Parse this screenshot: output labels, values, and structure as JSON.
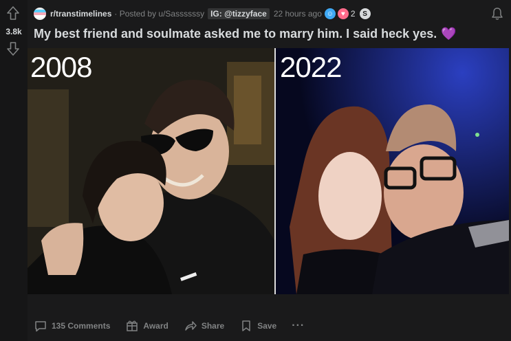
{
  "vote": {
    "count": "3.8k"
  },
  "meta": {
    "subreddit": "r/transtimelines",
    "posted_by": "· Posted by u/Sassssssy",
    "flair": "IG: @tizzyface",
    "time": "22 hours ago",
    "award_count": "2",
    "award_c_glyph": "S"
  },
  "post": {
    "title": "My best friend and soulmate asked me to marry him. I said heck yes.",
    "title_emoji": "💜"
  },
  "image": {
    "left_year": "2008",
    "right_year": "2022"
  },
  "actions": {
    "comments": "135 Comments",
    "award": "Award",
    "share": "Share",
    "save": "Save",
    "more": "···"
  },
  "colors": {
    "background": "#1a1a1b",
    "text": "#d7dadc",
    "muted": "#818384",
    "heart": "#a66efa"
  },
  "icons": [
    "upvote-icon",
    "downvote-icon",
    "bell-icon",
    "comment-icon",
    "award-icon",
    "share-icon",
    "save-icon"
  ]
}
